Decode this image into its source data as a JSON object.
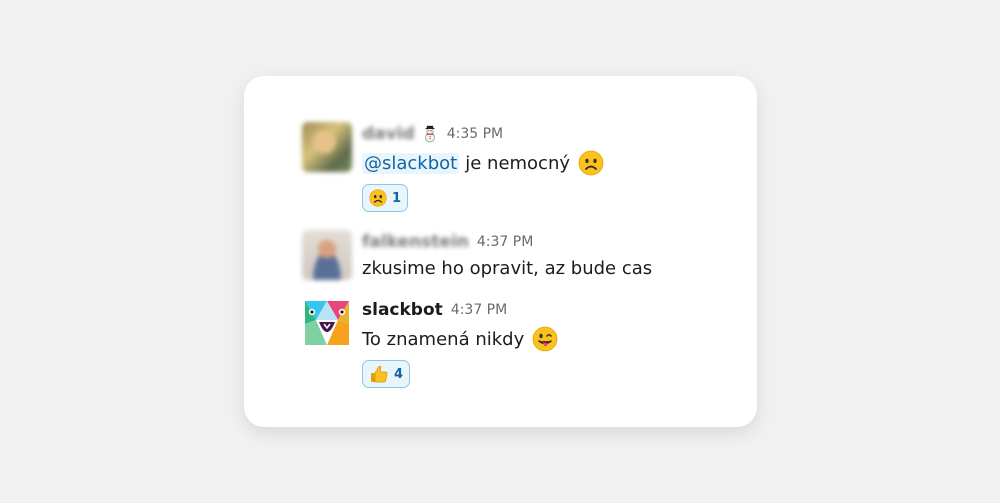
{
  "messages": [
    {
      "author": "david",
      "status_emoji_icon": "snowman-icon",
      "time": "4:35 PM",
      "mention": "@slackbot",
      "text": "je nemocný",
      "inline_emoji_icon": "frowning-face-icon",
      "reaction": {
        "icon": "frowning-face-icon",
        "count": "1"
      }
    },
    {
      "author": "falkenstein",
      "time": "4:37 PM",
      "text": "zkusime ho opravit, az bude cas"
    },
    {
      "author": "slackbot",
      "time": "4:37 PM",
      "text": "To znamená nikdy",
      "inline_emoji_icon": "winking-tongue-face-icon",
      "reaction": {
        "icon": "thumbs-up-icon",
        "count": "4"
      }
    }
  ],
  "colors": {
    "background": "#f1f1f1",
    "card": "#ffffff",
    "mention": "#1264a3",
    "reaction_border": "#8fc6e8",
    "reaction_bg": "#e8f5fa"
  }
}
